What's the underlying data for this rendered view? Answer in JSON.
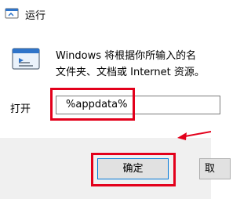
{
  "window": {
    "title": "运行",
    "app_icon": "run-icon"
  },
  "dialog": {
    "description_line1": "Windows 将根据你所输入的名",
    "description_line2": "文件夹、文档或 Internet 资源。",
    "open_label": "打开",
    "open_value": "%appdata%"
  },
  "buttons": {
    "ok_label": "确定",
    "cancel_label": "取"
  },
  "annotations": {
    "highlight_color": "#e3001b"
  }
}
